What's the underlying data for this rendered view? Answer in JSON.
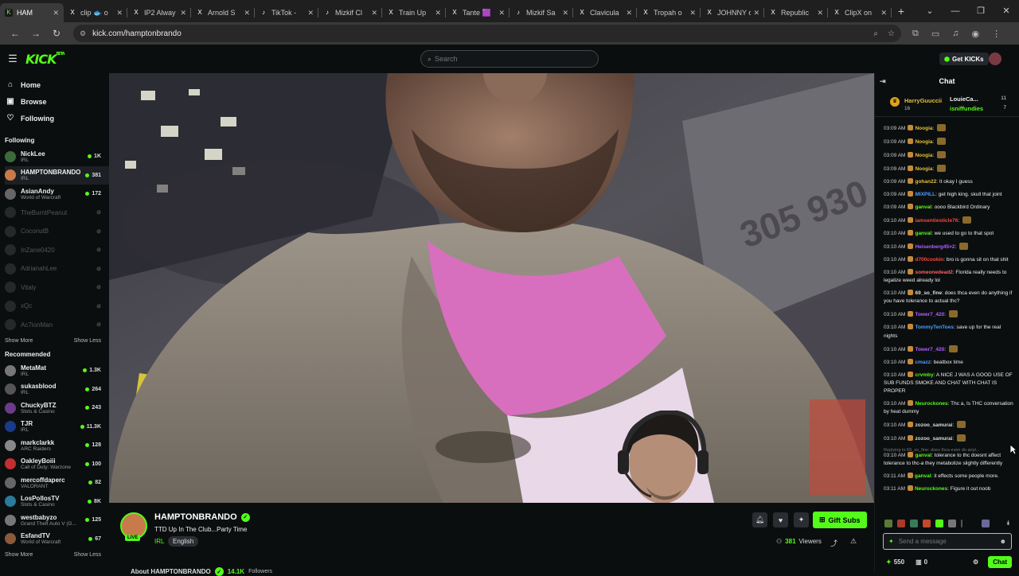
{
  "browser": {
    "tabs": [
      {
        "label": "HAM",
        "fav": "K",
        "favColor": "#53fc18",
        "active": true
      },
      {
        "label": "clip 🐟 o",
        "fav": "X",
        "favColor": "#ffffff"
      },
      {
        "label": "IP2 Alway",
        "fav": "X",
        "favColor": "#ffffff"
      },
      {
        "label": "Arnold S",
        "fav": "X",
        "favColor": "#ffffff"
      },
      {
        "label": "TikTok - ",
        "fav": "♪",
        "favColor": "#ffffff"
      },
      {
        "label": "Mizkif Cl",
        "fav": "♪",
        "favColor": "#ffffff"
      },
      {
        "label": "Train Up",
        "fav": "X",
        "favColor": "#ffffff"
      },
      {
        "label": "Tante 🟪",
        "fav": "X",
        "favColor": "#ffffff"
      },
      {
        "label": "Mizkif Sa",
        "fav": "♪",
        "favColor": "#ffffff"
      },
      {
        "label": "Clavicula",
        "fav": "X",
        "favColor": "#ffffff"
      },
      {
        "label": "Tropah o",
        "fav": "X",
        "favColor": "#ffffff"
      },
      {
        "label": "ЈOHNNY o",
        "fav": "X",
        "favColor": "#ffffff"
      },
      {
        "label": "Republic",
        "fav": "X",
        "favColor": "#ffffff"
      },
      {
        "label": "ClipX on",
        "fav": "X",
        "favColor": "#ffffff"
      }
    ],
    "url": "kick.com/hamptonbrando"
  },
  "header": {
    "logo": "KICK",
    "logo_badge": "BETA",
    "search_placeholder": "Search",
    "get_kicks": "Get KICKs",
    "accent": "#53fc18"
  },
  "sidebar": {
    "nav": [
      {
        "label": "Home",
        "icon": "home-icon"
      },
      {
        "label": "Browse",
        "icon": "browse-icon"
      },
      {
        "label": "Following",
        "icon": "heart-icon"
      }
    ],
    "following_title": "Following",
    "following": [
      {
        "name": "NickLee",
        "category": "IRL",
        "viewers": "1K",
        "color": "#3b6b3b"
      },
      {
        "name": "HAMPTONBRANDO",
        "category": "IRL",
        "viewers": "381",
        "color": "#c97a4a",
        "selected": true
      },
      {
        "name": "AsianAndy",
        "category": "World of Warcraft",
        "viewers": "172",
        "color": "#666"
      },
      {
        "name": "TheBurntPeanut",
        "category": "",
        "viewers": "",
        "color": "#444",
        "offline": true
      },
      {
        "name": "CoconutB",
        "category": "",
        "viewers": "",
        "color": "#444",
        "offline": true
      },
      {
        "name": "InZane0420",
        "category": "",
        "viewers": "",
        "color": "#444",
        "offline": true
      },
      {
        "name": "AdrianahLee",
        "category": "",
        "viewers": "",
        "color": "#444",
        "offline": true
      },
      {
        "name": "Vitaly",
        "category": "",
        "viewers": "",
        "color": "#444",
        "offline": true
      },
      {
        "name": "xQc",
        "category": "",
        "viewers": "",
        "color": "#444",
        "offline": true
      },
      {
        "name": "Ac7ionMan",
        "category": "",
        "viewers": "",
        "color": "#444",
        "offline": true
      }
    ],
    "show_more": "Show More",
    "show_less": "Show Less",
    "recommended_title": "Recommended",
    "recommended": [
      {
        "name": "MetaMat",
        "category": "IRL",
        "viewers": "1.3K",
        "color": "#777"
      },
      {
        "name": "sukasblood",
        "category": "IRL",
        "viewers": "264",
        "color": "#555"
      },
      {
        "name": "ChuckyBTZ",
        "category": "Slots & Casino",
        "viewers": "243",
        "color": "#6a3b8a"
      },
      {
        "name": "TJR",
        "category": "IRL",
        "viewers": "11.3K",
        "color": "#1a3a8a"
      },
      {
        "name": "markclarkk",
        "category": "ARC Raiders",
        "viewers": "128",
        "color": "#888"
      },
      {
        "name": "OakleyBoiii",
        "category": "Call of Duty: Warzone",
        "viewers": "100",
        "color": "#c03030"
      },
      {
        "name": "mercoffdaperc",
        "category": "VALORANT",
        "viewers": "82",
        "color": "#666"
      },
      {
        "name": "LosPollosTV",
        "category": "Slots & Casino",
        "viewers": "8K",
        "color": "#2a7a9a"
      },
      {
        "name": "westbabyzo",
        "category": "Grand Theft Auto V (G...",
        "viewers": "125",
        "color": "#777"
      },
      {
        "name": "EsfandTV",
        "category": "World of Warcraft",
        "viewers": "67",
        "color": "#8a5a3a"
      }
    ]
  },
  "stream": {
    "name": "HAMPTONBRANDO",
    "title": "TTD Up In The Club...Party Time",
    "category": "IRL",
    "language": "English",
    "live_label": "LIVE",
    "gift_subs": "Gift Subs",
    "viewers": "381",
    "viewers_label": "Viewers",
    "about": "About HAMPTONBRANDO",
    "followers": "14.1K",
    "followers_label": "Followers"
  },
  "chat": {
    "title": "Chat",
    "pinned": [
      {
        "user": "HarryGuuccii",
        "count": "16"
      },
      {
        "user": "LouieCa...",
        "count": "11"
      },
      {
        "user": "isniffundies",
        "count": "7"
      }
    ],
    "messages": [
      {
        "ts": "03:09 AM",
        "user": "Noogia",
        "color": "#e0c03a",
        "text": "",
        "emote": true
      },
      {
        "ts": "03:09 AM",
        "user": "Noogia",
        "color": "#e0c03a",
        "text": "",
        "emote": true
      },
      {
        "ts": "03:09 AM",
        "user": "Noogia",
        "color": "#e0c03a",
        "text": "",
        "emote": true
      },
      {
        "ts": "03:09 AM",
        "user": "Noogia",
        "color": "#e0c03a",
        "text": "",
        "emote": true
      },
      {
        "ts": "03:09 AM",
        "user": "gohan22",
        "color": "#e0c03a",
        "text": "It okay I guess"
      },
      {
        "ts": "03:09 AM",
        "user": "MIXPILL",
        "color": "#4a9fff",
        "text": "get high king. skull that joint"
      },
      {
        "ts": "03:09 AM",
        "user": "ganval",
        "color": "#53fc18",
        "text": "oooo Blackbird Ordinary"
      },
      {
        "ts": "03:10 AM",
        "user": "iamsentiesticle76",
        "color": "#ff4444",
        "text": "",
        "emote": true
      },
      {
        "ts": "03:10 AM",
        "user": "ganval",
        "color": "#53fc18",
        "text": "we used to go to that spot"
      },
      {
        "ts": "03:10 AM",
        "user": "Heisenberg45×2",
        "color": "#b060ff",
        "text": "",
        "emote": true
      },
      {
        "ts": "03:10 AM",
        "user": "d700cookin",
        "color": "#ff4444",
        "text": "bro is gonna sit on that shit"
      },
      {
        "ts": "03:10 AM",
        "user": "someonedead2",
        "color": "#ff6060",
        "text": "Florida really needs to legalize weed already lol"
      },
      {
        "ts": "03:10 AM",
        "user": "69_so_fine",
        "color": "#dddddd",
        "text": "does thca even do anything if you have tolerance to actual thc?"
      },
      {
        "ts": "03:10 AM",
        "user": "Tower7_420",
        "color": "#b060ff",
        "text": "",
        "emote": true
      },
      {
        "ts": "03:10 AM",
        "user": "TommyTenToes",
        "color": "#4a9fff",
        "text": "save up for the real nights"
      },
      {
        "ts": "03:10 AM",
        "user": "Tower7_420",
        "color": "#b060ff",
        "text": "",
        "emote": true
      },
      {
        "ts": "03:10 AM",
        "user": "cmazz",
        "color": "#4a9fff",
        "text": "beatbox time"
      },
      {
        "ts": "03:10 AM",
        "user": "crvmby",
        "color": "#53fc18",
        "text": "A NICE J WAS A GOOD USE OF SUB FUNDS SMOKE AND CHAT WITH CHAT IS PROPER"
      },
      {
        "ts": "03:10 AM",
        "user": "Neurockones",
        "color": "#53fc18",
        "text": "Thc a, Is THC conversation by heat dummy"
      },
      {
        "ts": "03:10 AM",
        "user": "zozoo_samurai",
        "color": "#dddddd",
        "text": "",
        "emote": true
      },
      {
        "ts": "03:10 AM",
        "user": "zozoo_samurai",
        "color": "#dddddd",
        "text": "",
        "emote": true
      },
      {
        "ts": "03:10 AM",
        "user": "ganval",
        "color": "#53fc18",
        "text": "tolerance to thc doesnt affect tolerance to thc-a they metabolize slightly differently",
        "reply": "Replying to 69_so_fine: does thca even do anyt..."
      },
      {
        "ts": "03:11 AM",
        "user": "ganval",
        "color": "#53fc18",
        "text": "it effects some people more."
      },
      {
        "ts": "03:11 AM",
        "user": "Neurockones",
        "color": "#53fc18",
        "text": "Figure it out noob"
      }
    ],
    "input_placeholder": "Send a message",
    "points": "550",
    "kicks": "0",
    "send": "Chat"
  }
}
